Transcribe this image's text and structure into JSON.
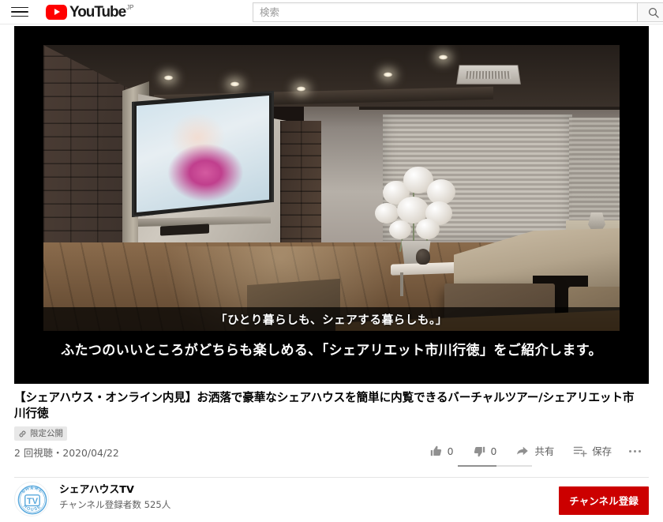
{
  "header": {
    "menu_icon": "hamburger-icon",
    "logo_text": "YouTube",
    "logo_country": "JP",
    "search_placeholder": "検索",
    "search_value": "",
    "search_button_icon": "search-icon"
  },
  "player": {
    "caption_line1": "「ひとり暮らしも、シェアする暮らしも。」",
    "caption_line2": "ふたつのいいところがどちらも楽しめる、「シェアリエット市川行徳」をご紹介します。",
    "scene_description": "シェアハウス内観 — 壁掛けテレビ、レンガ壁、ソファ、木製テーブル"
  },
  "video": {
    "title": "【シェアハウス・オンライン内見】お洒落で豪華なシェアハウスを簡単に内覧できるバーチャルツアー/シェアリエット市川行徳",
    "privacy_badge": "限定公開",
    "privacy_icon": "link-icon",
    "views_and_date": "2 回視聴・2020/04/22"
  },
  "actions": {
    "like_icon": "thumbs-up-icon",
    "like_count": "0",
    "dislike_icon": "thumbs-down-icon",
    "dislike_count": "0",
    "share_icon": "share-arrow-icon",
    "share_label": "共有",
    "save_icon": "playlist-add-icon",
    "save_label": "保存",
    "more_icon": "more-horizontal-icon",
    "rating_fill_percent": 52
  },
  "channel": {
    "avatar_icon": "channel-avatar",
    "avatar_top_text": "SHARE",
    "avatar_bottom_text": "HOUSE",
    "avatar_monogram": "TV",
    "name": "シェアハウスTV",
    "subscribers": "チャンネル登録者数 525人",
    "subscribe_label": "チャンネル登録"
  },
  "colors": {
    "brand_red": "#ff0000",
    "subscribe_red": "#cc0000",
    "text_primary": "#030303",
    "text_secondary": "#606060",
    "avatar_blue": "#5aa9dd"
  }
}
